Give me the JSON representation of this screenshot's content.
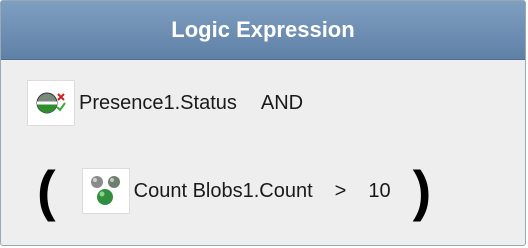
{
  "header": {
    "title": "Logic Expression"
  },
  "row1": {
    "operand": "Presence1.Status",
    "operator": "AND",
    "icon": "presence-status-icon"
  },
  "row2": {
    "open_paren": "(",
    "operand": "Count Blobs1.Count",
    "comparator": ">",
    "value": "10",
    "close_paren": ")",
    "icon": "count-blobs-icon"
  },
  "colors": {
    "header_bg": "#6f90b4",
    "panel_bg": "#eeeeee",
    "header_text": "#ffffff"
  }
}
